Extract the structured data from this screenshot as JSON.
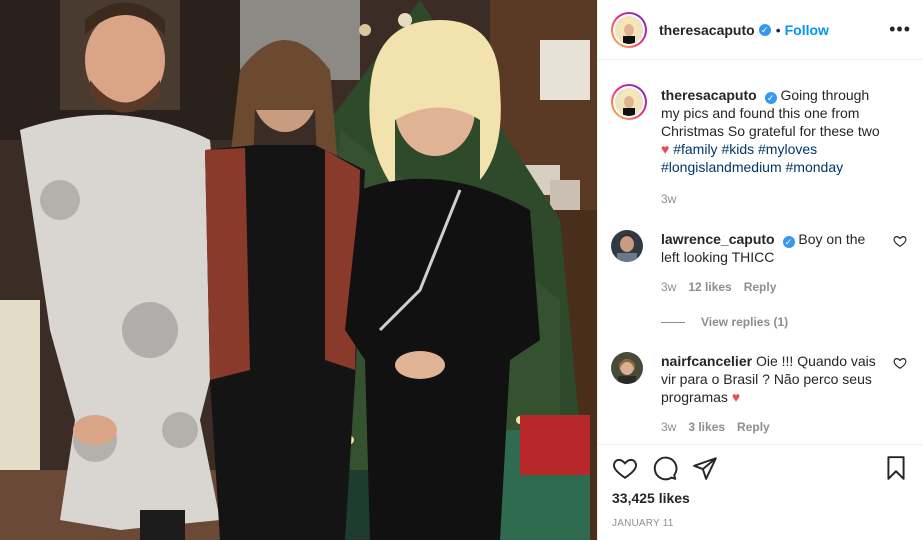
{
  "post": {
    "username": "theresacaputo",
    "follow_label": "Follow",
    "more_icon": "more-options-icon",
    "caption": {
      "username": "theresacaputo",
      "text": "Going through my pics and found this one from Christmas So grateful for these two",
      "hashtags_1": "#family #kids #myloves",
      "hashtags_2": "#longislandmedium #monday",
      "time": "3w"
    },
    "comments": [
      {
        "username": "lawrence_caputo",
        "text": "Boy on the left looking THICC",
        "time": "3w",
        "likes": "12 likes",
        "reply_label": "Reply",
        "view_replies": "View replies (1)"
      },
      {
        "username": "nairfcancelier",
        "text": "Oie !!! Quando vais vir para o Brasil ? Não perco seus programas",
        "time": "3w",
        "likes": "3 likes",
        "reply_label": "Reply"
      }
    ],
    "likes_count": "33,425 likes",
    "date": "JANUARY 11"
  },
  "colors": {
    "link_blue": "#0095f6",
    "hashtag": "#00376b",
    "muted": "#8e8e8e",
    "heart": "#ed4956",
    "verified": "#3897f0"
  }
}
